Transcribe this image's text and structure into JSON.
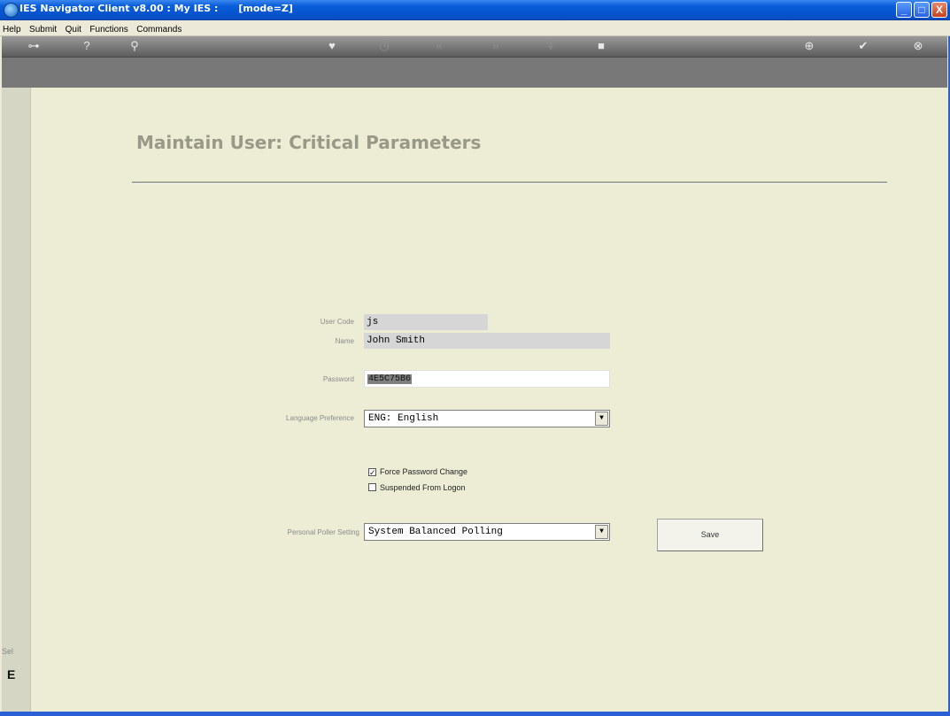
{
  "window": {
    "title": "IES Navigator Client v8.00 : My IES :      [mode=Z]",
    "minimize": "_",
    "maximize": "□",
    "close": "X"
  },
  "menu": [
    "Help",
    "Submit",
    "Quit",
    "Functions",
    "Commands"
  ],
  "toolbar": {
    "icons": [
      {
        "name": "key-icon",
        "glyph": "⊶"
      },
      {
        "name": "help-icon",
        "glyph": "?"
      },
      {
        "name": "search-icon",
        "glyph": "⚲"
      },
      {
        "name": "heart-icon",
        "glyph": "♥"
      },
      {
        "name": "clock-icon",
        "glyph": "◷"
      },
      {
        "name": "prev-icon",
        "glyph": "«"
      },
      {
        "name": "next-icon",
        "glyph": "»"
      },
      {
        "name": "tree-icon",
        "glyph": "⸸"
      },
      {
        "name": "stop-icon",
        "glyph": "■"
      },
      {
        "name": "add-icon",
        "glyph": "⊕"
      },
      {
        "name": "check-icon",
        "glyph": "✔"
      },
      {
        "name": "cancel-icon",
        "glyph": "⊗"
      }
    ]
  },
  "left_strip": {
    "label": "Sel",
    "glyph": "E"
  },
  "form": {
    "title": "Maintain User: Critical Parameters",
    "user_code_label": "User Code",
    "user_code_value": "js",
    "name_label": "Name",
    "name_value": "John Smith",
    "password_label": "Password",
    "password_value": "4E5C75B6",
    "language_label": "Language Preference",
    "language_value": "ENG: English",
    "force_password_label": "Force Password Change",
    "force_password_checked": true,
    "suspended_label": "Suspended From Logon",
    "suspended_checked": false,
    "poller_label": "Personal Poller Setting",
    "poller_value": "System Balanced Polling",
    "save_label": "Save",
    "dropdown_glyph": "▼",
    "check_glyph": "✓"
  }
}
